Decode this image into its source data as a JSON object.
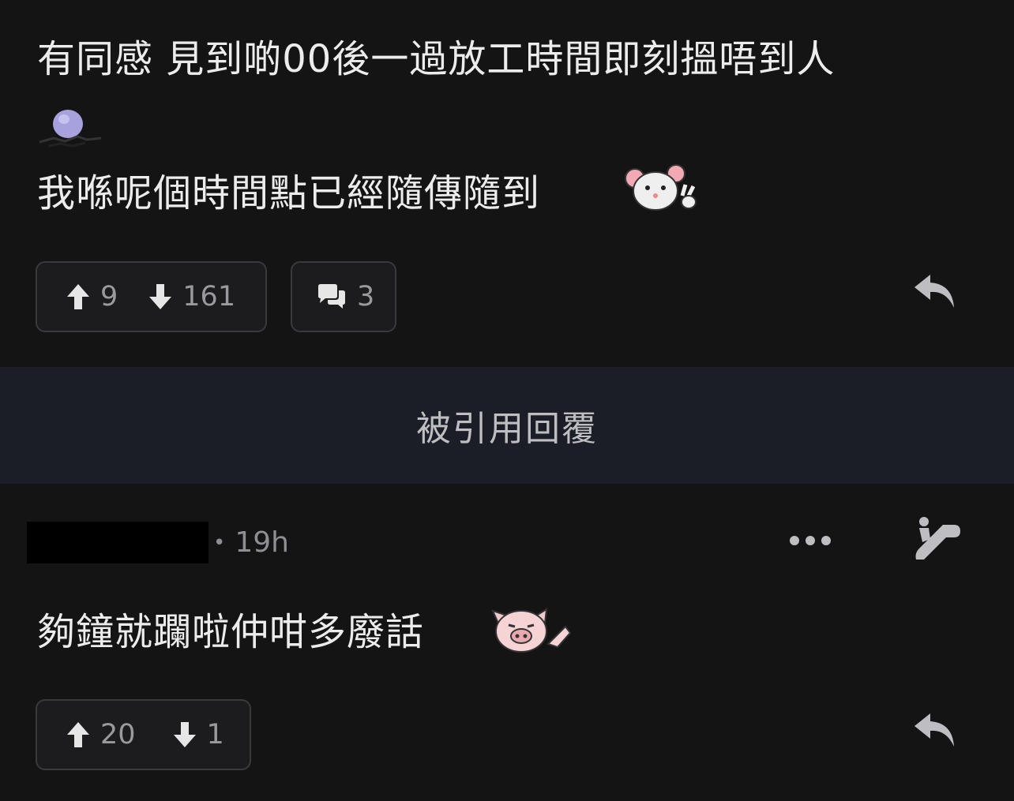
{
  "post1": {
    "line1": "有同感 見到啲00後一過放工時間即刻搵唔到人",
    "line3": "我喺呢個時間點已經隨傳隨到",
    "upvotes": "9",
    "downvotes": "161",
    "comments": "3",
    "icons": [
      "upvote-arrow-icon",
      "downvote-arrow-icon",
      "comment-bubbles-icon",
      "reply-arrow-icon"
    ],
    "stickers": [
      "purple-ball-sticker",
      "white-mouse-sticker"
    ]
  },
  "quoted_bar": {
    "label": "被引用回覆"
  },
  "post2": {
    "time": "19h",
    "text": "夠鐘就躝啦仲咁多廢話",
    "upvotes": "20",
    "downvotes": "1",
    "icons": [
      "more-options-icon",
      "escalator-icon",
      "upvote-arrow-icon",
      "downvote-arrow-icon",
      "reply-arrow-icon"
    ],
    "stickers": [
      "pink-pig-sticker"
    ]
  },
  "colors": {
    "background": "#141415",
    "quoted_bar": "#1b1e27",
    "button_border": "#3a3a3d",
    "text": "#ececec",
    "muted": "#9a9a9e"
  }
}
